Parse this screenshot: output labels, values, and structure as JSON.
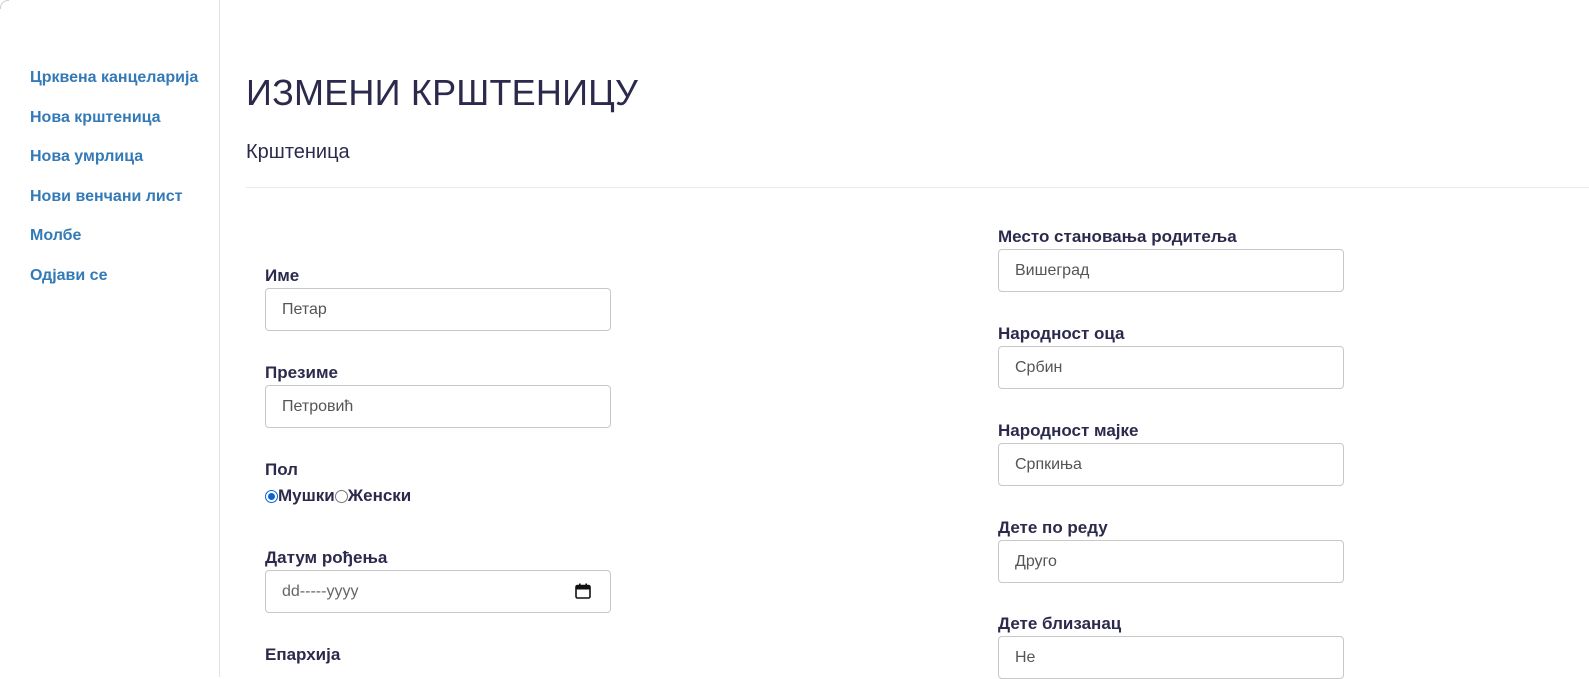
{
  "sidebar": {
    "items": [
      {
        "label": "Црквена канцеларија"
      },
      {
        "label": "Нова крштеница"
      },
      {
        "label": "Нова умрлица"
      },
      {
        "label": "Нови венчани лист"
      },
      {
        "label": "Молбе"
      },
      {
        "label": "Одјави се"
      }
    ]
  },
  "header": {
    "title": "ИЗМЕНИ КРШТЕНИЦУ",
    "subtitle": "Крштеница"
  },
  "form": {
    "left": {
      "first_name": {
        "label": "Име",
        "value": "Петар"
      },
      "last_name": {
        "label": "Презиме",
        "value": "Петровић"
      },
      "gender": {
        "label": "Пол",
        "options": [
          {
            "label": "Мушки",
            "checked": true
          },
          {
            "label": "Женски",
            "checked": false
          }
        ]
      },
      "birth_date": {
        "label": "Датум рођења",
        "placeholder": "dd-----yyyy"
      },
      "eparchy": {
        "label": "Епархија"
      }
    },
    "right": {
      "parents_residence": {
        "label": "Место становања родитеља",
        "value": "Вишеград"
      },
      "father_nationality": {
        "label": "Народност оца",
        "value": "Србин"
      },
      "mother_nationality": {
        "label": "Народност мајке",
        "value": "Српкиња"
      },
      "child_order": {
        "label": "Дете по реду",
        "value": "Друго"
      },
      "twin": {
        "label": "Дете близанац",
        "value": "Не"
      }
    }
  },
  "colors": {
    "link": "#337ab7",
    "heading": "#2b2a4c",
    "radio_accent": "#0a66d6",
    "input_border": "#c8c8c8"
  }
}
